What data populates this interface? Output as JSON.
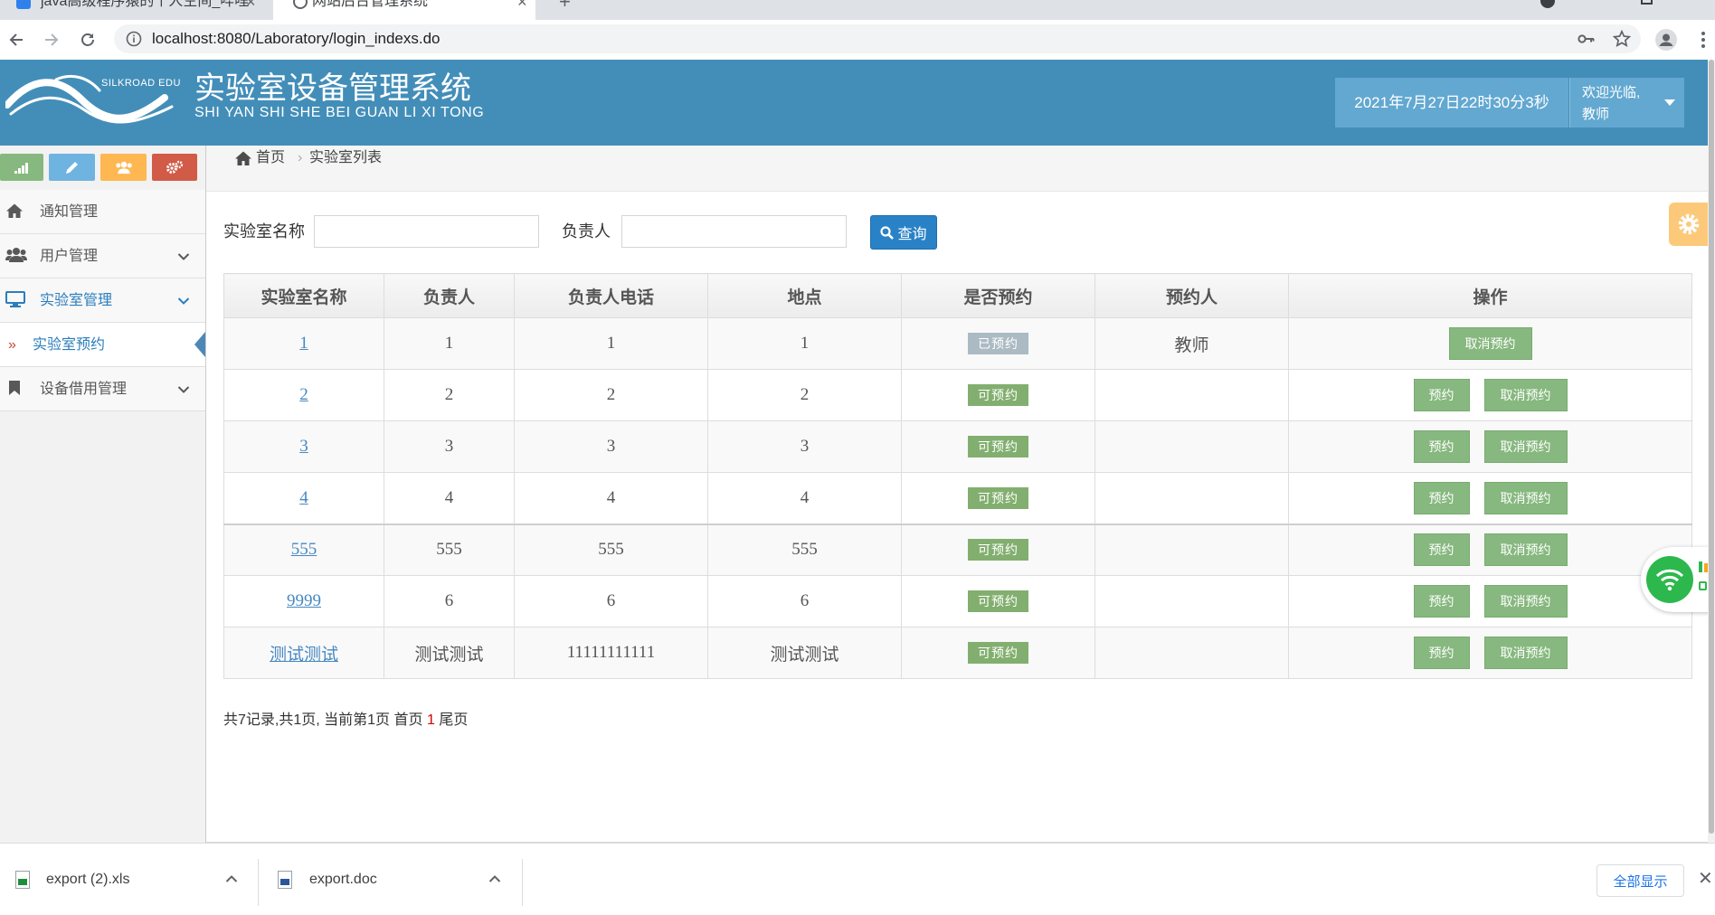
{
  "browser": {
    "tabs": [
      {
        "title": "java高级程序猿的个人空间_哔哩",
        "active": false
      },
      {
        "title": "网站后台管理系统",
        "active": true
      }
    ],
    "url": "localhost:8080/Laboratory/login_indexs.do"
  },
  "header": {
    "logo_text": "SILKROAD EDU",
    "title": "实验室设备管理系统",
    "subtitle": "SHI YAN SHI SHE BEI GUAN LI XI TONG",
    "datetime": "2021年7月27日22时30分3秒",
    "welcome": "欢迎光临,",
    "user": "教师",
    "color": "#438eb9",
    "box_color": "#62a8d1"
  },
  "sidebar": {
    "shortcuts": [
      {
        "icon": "signal-icon",
        "color": "#87b87f"
      },
      {
        "icon": "pencil-icon",
        "color": "#6fb3e0"
      },
      {
        "icon": "users-icon",
        "color": "#ffb752"
      },
      {
        "icon": "cogs-icon",
        "color": "#d15b47"
      }
    ],
    "menu": [
      {
        "label": "通知管理",
        "icon": "home-icon"
      },
      {
        "label": "用户管理",
        "icon": "users-icon",
        "expandable": true
      },
      {
        "label": "实验室管理",
        "icon": "desktop-icon",
        "expandable": true,
        "open": true
      },
      {
        "label": "实验室预约",
        "submenu": true,
        "active": true
      },
      {
        "label": "设备借用管理",
        "icon": "bookmark-icon",
        "expandable": true
      }
    ]
  },
  "breadcrumb": {
    "home": "首页",
    "current": "实验室列表"
  },
  "search": {
    "name_label": "实验室名称",
    "name_value": "",
    "manager_label": "负责人",
    "manager_value": "",
    "button": "查询"
  },
  "table": {
    "headers": [
      "实验室名称",
      "负责人",
      "负责人电话",
      "地点",
      "是否预约",
      "预约人",
      "操作"
    ],
    "rows": [
      {
        "name": "1",
        "manager": "1",
        "phone": "1",
        "location": "1",
        "status": "已预约",
        "status_color": "#abbac3",
        "booker": "教师",
        "actions": [
          {
            "label": "取消预约",
            "type": "cancel"
          }
        ]
      },
      {
        "name": "2",
        "manager": "2",
        "phone": "2",
        "location": "2",
        "status": "可预约",
        "status_color": "#82af6f",
        "booker": "",
        "actions": [
          {
            "label": "预约",
            "type": "reserve"
          },
          {
            "label": "取消预约",
            "type": "cancel"
          }
        ]
      },
      {
        "name": "3",
        "manager": "3",
        "phone": "3",
        "location": "3",
        "status": "可预约",
        "status_color": "#82af6f",
        "booker": "",
        "actions": [
          {
            "label": "预约",
            "type": "reserve"
          },
          {
            "label": "取消预约",
            "type": "cancel"
          }
        ]
      },
      {
        "name": "4",
        "manager": "4",
        "phone": "4",
        "location": "4",
        "status": "可预约",
        "status_color": "#82af6f",
        "booker": "",
        "actions": [
          {
            "label": "预约",
            "type": "reserve"
          },
          {
            "label": "取消预约",
            "type": "cancel"
          }
        ]
      },
      {
        "name": "555",
        "manager": "555",
        "phone": "555",
        "location": "555",
        "status": "可预约",
        "status_color": "#82af6f",
        "booker": "",
        "actions": [
          {
            "label": "预约",
            "type": "reserve"
          },
          {
            "label": "取消预约",
            "type": "cancel"
          }
        ]
      },
      {
        "name": "9999",
        "manager": "6",
        "phone": "6",
        "location": "6",
        "status": "可预约",
        "status_color": "#82af6f",
        "booker": "",
        "actions": [
          {
            "label": "预约",
            "type": "reserve"
          },
          {
            "label": "取消预约",
            "type": "cancel"
          }
        ]
      },
      {
        "name": "测试测试",
        "manager": "测试测试",
        "phone": "11111111111",
        "location": "测试测试",
        "status": "可预约",
        "status_color": "#82af6f",
        "booker": "",
        "actions": [
          {
            "label": "预约",
            "type": "reserve"
          },
          {
            "label": "取消预约",
            "type": "cancel"
          }
        ]
      }
    ]
  },
  "pagination": {
    "summary": "共7记录,共1页, 当前第1页",
    "first": "首页",
    "current": "1",
    "last": "尾页"
  },
  "downloads": {
    "items": [
      {
        "name": "export (2).xls",
        "type": "xls",
        "color": "#1e8e3e"
      },
      {
        "name": "export.doc",
        "type": "doc",
        "color": "#2b579a"
      }
    ],
    "show_all": "全部显示"
  }
}
